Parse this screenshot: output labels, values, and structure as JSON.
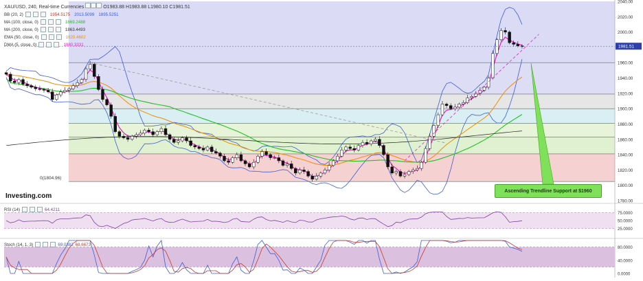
{
  "header": {
    "symbol": "XAU/USD, 240, Real-time Currencies",
    "o": "O1983.88",
    "h": "H1983.88",
    "l": "L1980.10",
    "c": "C1981.51"
  },
  "indicators": [
    {
      "label": "BB (20, 2)",
      "v1": "1954.5175",
      "v2": "2013.5099",
      "v3": "1895.5251",
      "c1": "#c0392b",
      "c2": "#3b5bdb",
      "c3": "#3b5bdb"
    },
    {
      "label": "MA (100, close, 0)",
      "v1": "1869.2488",
      "c1": "#22c022"
    },
    {
      "label": "MA (200, close, 0)",
      "v1": "1863.4493",
      "c1": "#333333"
    },
    {
      "label": "EMA (50, close, 0)",
      "v1": "1920.4602",
      "c1": "#f08c00"
    },
    {
      "label": "DMA (5, close, 0)",
      "v1": "1980.3331",
      "c1": "#e020c0"
    }
  ],
  "price_axis": {
    "ticks": [
      "2040.00",
      "2020.00",
      "2000.00",
      "1980.00",
      "1960.00",
      "1940.00",
      "1920.00",
      "1900.00",
      "1880.00",
      "1860.00",
      "1840.00",
      "1820.00",
      "1800.00",
      "1780.00"
    ],
    "current": "1981.51"
  },
  "rsi": {
    "label": "RSI (14)",
    "value": "64.4211",
    "ticks": [
      "75.0000",
      "50.0000",
      "25.0000"
    ]
  },
  "stoch": {
    "label": "Stoch (14, 1, 3)",
    "v1": "69.0383",
    "v2": "68.6673",
    "ticks": [
      "80.0000",
      "40.0000",
      "0.0000"
    ]
  },
  "annotation": "Ascending Trendline Support at $1960",
  "low_label": "0(1804.96)",
  "logo": "Investing.com",
  "colors": {
    "accent_green": "#5ad23a",
    "bb": "#3b5bdb",
    "ma100": "#22c022",
    "ema50": "#f08c00",
    "dma5": "#e020c0"
  },
  "chart_data": {
    "type": "candlestick",
    "ylim": [
      1780,
      2040
    ],
    "fib_levels": [
      1804.96,
      1841,
      1863,
      1881,
      1900,
      1919,
      1960
    ],
    "closes": [
      1945,
      1936,
      1934,
      1938,
      1932,
      1930,
      1928,
      1926,
      1925,
      1924,
      1922,
      1912,
      1918,
      1922,
      1924,
      1926,
      1930,
      1934,
      1938,
      1952,
      1958,
      1942,
      1925,
      1912,
      1905,
      1890,
      1870,
      1864,
      1862,
      1860,
      1864,
      1866,
      1868,
      1872,
      1870,
      1866,
      1870,
      1874,
      1866,
      1860,
      1856,
      1858,
      1862,
      1858,
      1852,
      1850,
      1848,
      1846,
      1850,
      1844,
      1842,
      1838,
      1832,
      1830,
      1836,
      1840,
      1832,
      1828,
      1824,
      1830,
      1838,
      1844,
      1840,
      1836,
      1836,
      1832,
      1826,
      1828,
      1822,
      1816,
      1820,
      1818,
      1812,
      1808,
      1812,
      1816,
      1820,
      1826,
      1832,
      1838,
      1846,
      1850,
      1848,
      1846,
      1852,
      1856,
      1854,
      1858,
      1860,
      1852,
      1840,
      1824,
      1816,
      1818,
      1812,
      1814,
      1818,
      1820,
      1822,
      1830,
      1848,
      1864,
      1878,
      1892,
      1906,
      1904,
      1900,
      1902,
      1906,
      1908,
      1914,
      1916,
      1920,
      1924,
      1928,
      1940,
      1972,
      1990,
      2002,
      2000,
      1986,
      1984,
      1982,
      1981.51
    ],
    "trendlines": [
      {
        "from": [
          20,
          1960
        ],
        "to": [
          105,
          1855
        ],
        "style": "dashed-grey"
      },
      {
        "from": [
          95,
          1832
        ],
        "to": [
          127,
          1997
        ],
        "style": "dashed-magenta"
      }
    ]
  }
}
